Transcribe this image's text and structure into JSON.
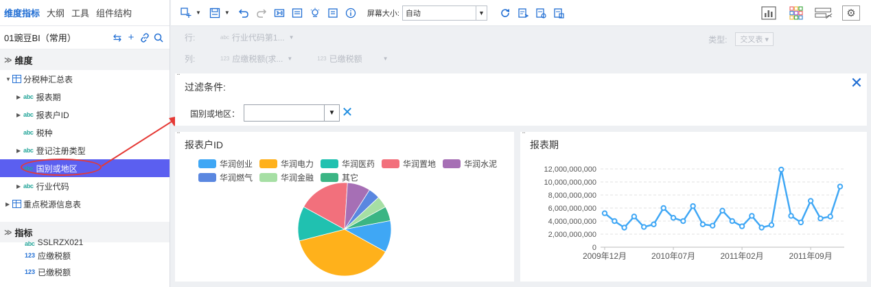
{
  "left": {
    "tabs": [
      "维度指标",
      "大纲",
      "工具",
      "组件结构"
    ],
    "datasource": "01豌豆BI（常用）",
    "dimension_header": "维度",
    "dimension_tree": [
      {
        "label": "分税种汇总表",
        "type": "table",
        "indent": 0,
        "expand": "▼"
      },
      {
        "label": "报表期",
        "type": "abc",
        "indent": 1,
        "expand": "▶"
      },
      {
        "label": "报表户ID",
        "type": "abc",
        "indent": 1,
        "expand": "▶"
      },
      {
        "label": "税种",
        "type": "abc",
        "indent": 1,
        "expand": ""
      },
      {
        "label": "登记注册类型",
        "type": "abc",
        "indent": 1,
        "expand": "▶"
      },
      {
        "label": "国别或地区",
        "type": "abc",
        "indent": 1,
        "expand": "",
        "selected": true
      },
      {
        "label": "行业代码",
        "type": "abc",
        "indent": 1,
        "expand": "▶"
      },
      {
        "label": "重点税源信息表",
        "type": "table",
        "indent": 0,
        "expand": "▶"
      }
    ],
    "measure_header": "指标",
    "measure_tree": [
      {
        "label": "SSLRZX021",
        "type": "abc"
      },
      {
        "label": "应缴税额",
        "type": "123"
      },
      {
        "label": "已缴税额",
        "type": "123"
      }
    ],
    "type_tags": {
      "abc": "abc",
      "123": "123"
    }
  },
  "toolbar": {
    "screen_size_label": "屏幕大小:",
    "screen_size_value": "自动"
  },
  "shelf": {
    "row_label": "行:",
    "col_label": "列:",
    "row_pills": [
      {
        "tag": "abc",
        "label": "行业代码第1..."
      }
    ],
    "col_pills": [
      {
        "tag": "123",
        "label": "应缴税额(求..."
      },
      {
        "tag": "123",
        "label": "已缴税额"
      }
    ],
    "type_label": "类型:",
    "type_value": "交叉表 ▾"
  },
  "filter": {
    "title": "过滤条件:",
    "field_label": "国别或地区：",
    "field_value": ""
  },
  "pie": {
    "title": "报表户ID"
  },
  "line": {
    "title": "报表期"
  },
  "chart_data": [
    {
      "type": "pie",
      "title": "报表户ID",
      "categories": [
        "华润创业",
        "华润电力",
        "华润医药",
        "华润置地",
        "华润水泥",
        "华润燃气",
        "华润金融",
        "其它"
      ],
      "values": [
        11,
        38,
        12,
        18,
        8,
        4,
        4,
        5
      ],
      "colors": [
        "#3fa7f5",
        "#ffb11b",
        "#20c1b0",
        "#f2707c",
        "#a66fb5",
        "#5a87e0",
        "#a6dfa4",
        "#3bb584"
      ],
      "legend": "top"
    },
    {
      "type": "line",
      "title": "报表期",
      "x_ticks": [
        "2009年12月",
        "2010年07月",
        "2011年02月",
        "2011年09月"
      ],
      "values": [
        5200000000,
        4000000000,
        3000000000,
        4700000000,
        3100000000,
        3500000000,
        6000000000,
        4500000000,
        4000000000,
        6300000000,
        3500000000,
        3300000000,
        5600000000,
        4000000000,
        3200000000,
        4800000000,
        3000000000,
        3400000000,
        11900000000,
        4800000000,
        3800000000,
        7100000000,
        4400000000,
        4700000000,
        9300000000
      ],
      "y_ticks": [
        0,
        2000000000,
        4000000000,
        6000000000,
        8000000000,
        10000000000,
        12000000000
      ],
      "y_tick_labels": [
        "0",
        "2,000,000,000",
        "4,000,000,000",
        "6,000,000,000",
        "8,000,000,000",
        "10,000,000,000",
        "12,000,000,000"
      ],
      "ylim": [
        0,
        12000000000
      ],
      "color": "#3fa7f5",
      "grid": true
    }
  ]
}
